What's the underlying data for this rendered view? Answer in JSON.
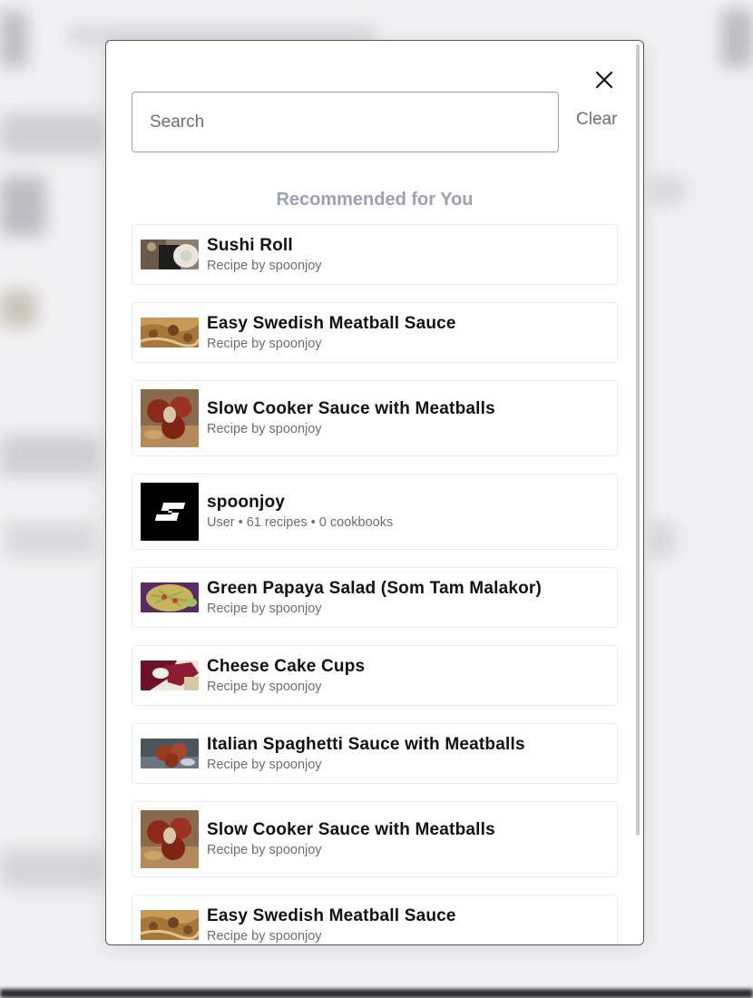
{
  "modal": {
    "close_icon": "close-icon",
    "search": {
      "placeholder": "Search",
      "value": ""
    },
    "clear_label": "Clear",
    "heading": "Recommended for You"
  },
  "results": [
    {
      "title": "Sushi Roll",
      "subtitle": "Recipe by spoonjoy",
      "thumb": "sushi-roll-photo"
    },
    {
      "title": "Easy Swedish Meatball Sauce",
      "subtitle": "Recipe by spoonjoy",
      "thumb": "swedish-meatball-photo"
    },
    {
      "title": "Slow Cooker Sauce with Meatballs",
      "subtitle": "Recipe by spoonjoy",
      "thumb": "slow-cooker-meatballs-photo"
    },
    {
      "title": "spoonjoy",
      "subtitle": "User • 61 recipes • 0 cookbooks",
      "thumb": "spoonjoy-logo"
    },
    {
      "title": "Green Papaya Salad (Som Tam Malakor)",
      "subtitle": "Recipe by spoonjoy",
      "thumb": "papaya-salad-photo"
    },
    {
      "title": "Cheese Cake Cups",
      "subtitle": "Recipe by spoonjoy",
      "thumb": "cheesecake-cups-photo"
    },
    {
      "title": "Italian Spaghetti Sauce with Meatballs",
      "subtitle": "Recipe by spoonjoy",
      "thumb": "spaghetti-meatballs-photo"
    },
    {
      "title": "Slow Cooker Sauce with Meatballs",
      "subtitle": "Recipe by spoonjoy",
      "thumb": "slow-cooker-meatballs-photo"
    },
    {
      "title": "Easy Swedish Meatball Sauce",
      "subtitle": "Recipe by spoonjoy",
      "thumb": "swedish-meatball-photo"
    }
  ]
}
